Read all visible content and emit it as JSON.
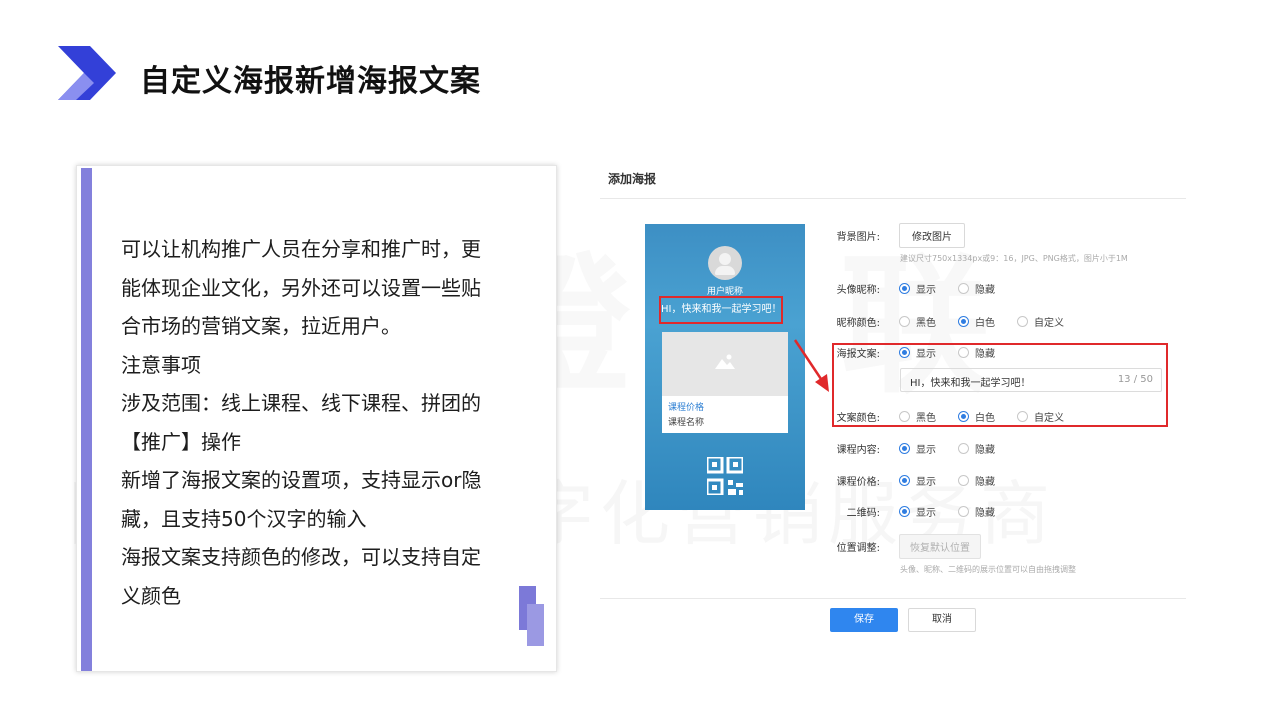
{
  "slide": {
    "title": "自定义海报新增海报文案",
    "body_lines": [
      "可以让机构推广人员在分享和推广时，更",
      "能体现企业文化，另外还可以设置一些贴",
      "合市场的营销文案，拉近用户。",
      "注意事项",
      "涉及范围：线上课程、线下课程、拼团的",
      "【推广】操作",
      "新增了海报文案的设置项，支持显示or隐",
      "藏，且支持50个汉字的输入",
      "海报文案支持颜色的修改，可以支持自定",
      "义颜色"
    ],
    "accent_color": "#8380dc"
  },
  "dialog": {
    "title": "添加海报",
    "poster": {
      "nickname": "用户昵称",
      "copy": "HI，快来和我一起学习吧！",
      "course_price": "课程价格",
      "course_name": "课程名称"
    },
    "bg_image": {
      "label": "背景图片:",
      "button": "修改图片",
      "hint": "建议尺寸750x1334px或9：16，JPG、PNG格式，图片小于1M"
    },
    "avatar_nick": {
      "label": "头像昵称:",
      "options": [
        "显示",
        "隐藏"
      ],
      "selected": "显示"
    },
    "nick_color": {
      "label": "昵称颜色:",
      "options": [
        "黑色",
        "白色",
        "自定义"
      ],
      "selected": "白色"
    },
    "poster_copy": {
      "label": "海报文案:",
      "options": [
        "显示",
        "隐藏"
      ],
      "selected": "显示",
      "value": "HI，快来和我一起学习吧！",
      "count": "13 / 50"
    },
    "copy_color": {
      "label": "文案颜色:",
      "options": [
        "黑色",
        "白色",
        "自定义"
      ],
      "selected": "白色"
    },
    "course_content": {
      "label": "课程内容:",
      "options": [
        "显示",
        "隐藏"
      ],
      "selected": "显示"
    },
    "course_price": {
      "label": "课程价格:",
      "options": [
        "显示",
        "隐藏"
      ],
      "selected": "显示"
    },
    "qr_code": {
      "label": "二维码:",
      "options": [
        "显示",
        "隐藏"
      ],
      "selected": "显示"
    },
    "position": {
      "label": "位置调整:",
      "button": "恢复默认位置",
      "hint": "头像、昵称、二维码的展示位置可以自由拖拽调整"
    },
    "save": "保存",
    "cancel": "取消",
    "highlight_color": "#e0292b",
    "primary_color": "#2f86ef"
  }
}
